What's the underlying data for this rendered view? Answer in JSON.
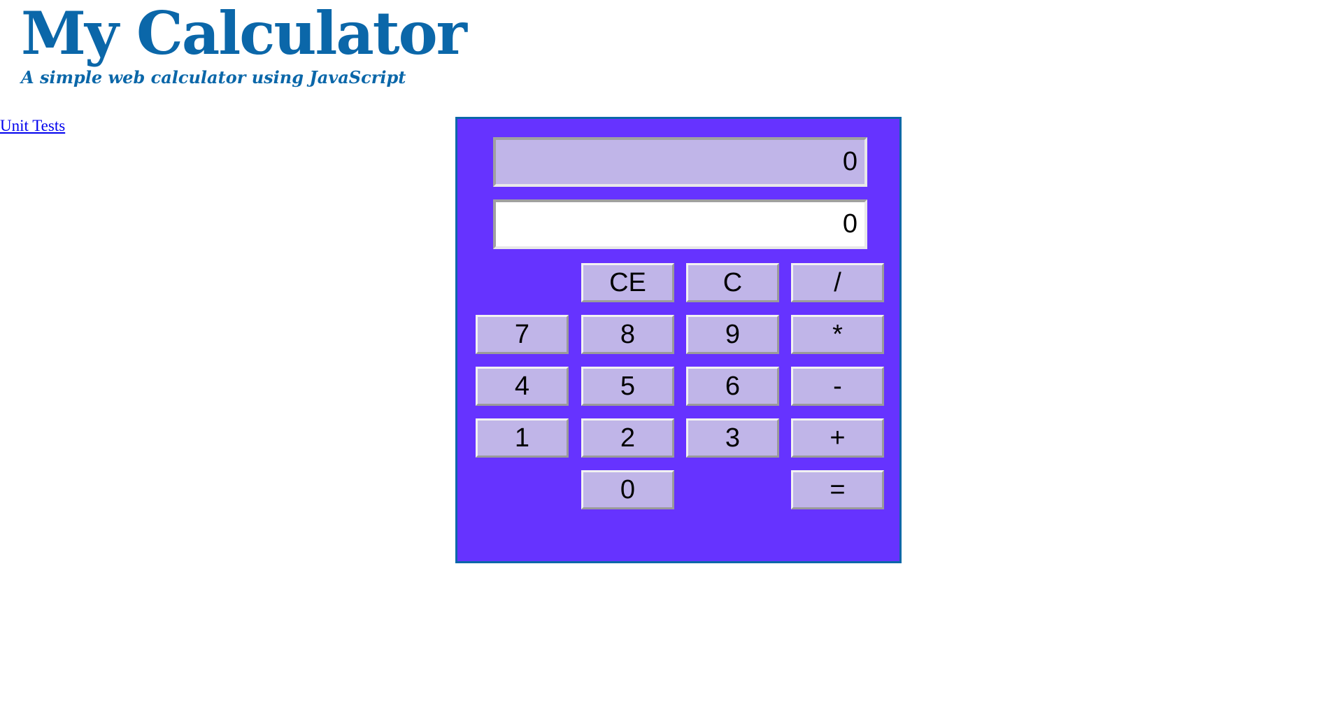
{
  "header": {
    "title": "My Calculator",
    "subtitle": "A simple web calculator using JavaScript"
  },
  "links": {
    "unit_tests": "Unit Tests"
  },
  "calculator": {
    "history_display_value": "0",
    "main_display_value": "0",
    "buttons": {
      "ce": "CE",
      "c": "C",
      "divide": "/",
      "seven": "7",
      "eight": "8",
      "nine": "9",
      "multiply": "*",
      "four": "4",
      "five": "5",
      "six": "6",
      "subtract": "-",
      "one": "1",
      "two": "2",
      "three": "3",
      "add": "+",
      "zero": "0",
      "equals": "="
    }
  },
  "colors": {
    "brand_blue": "#0b67a9",
    "calculator_background": "#6633ff",
    "button_face": "#c0b5e8",
    "link": "#0000ee"
  }
}
